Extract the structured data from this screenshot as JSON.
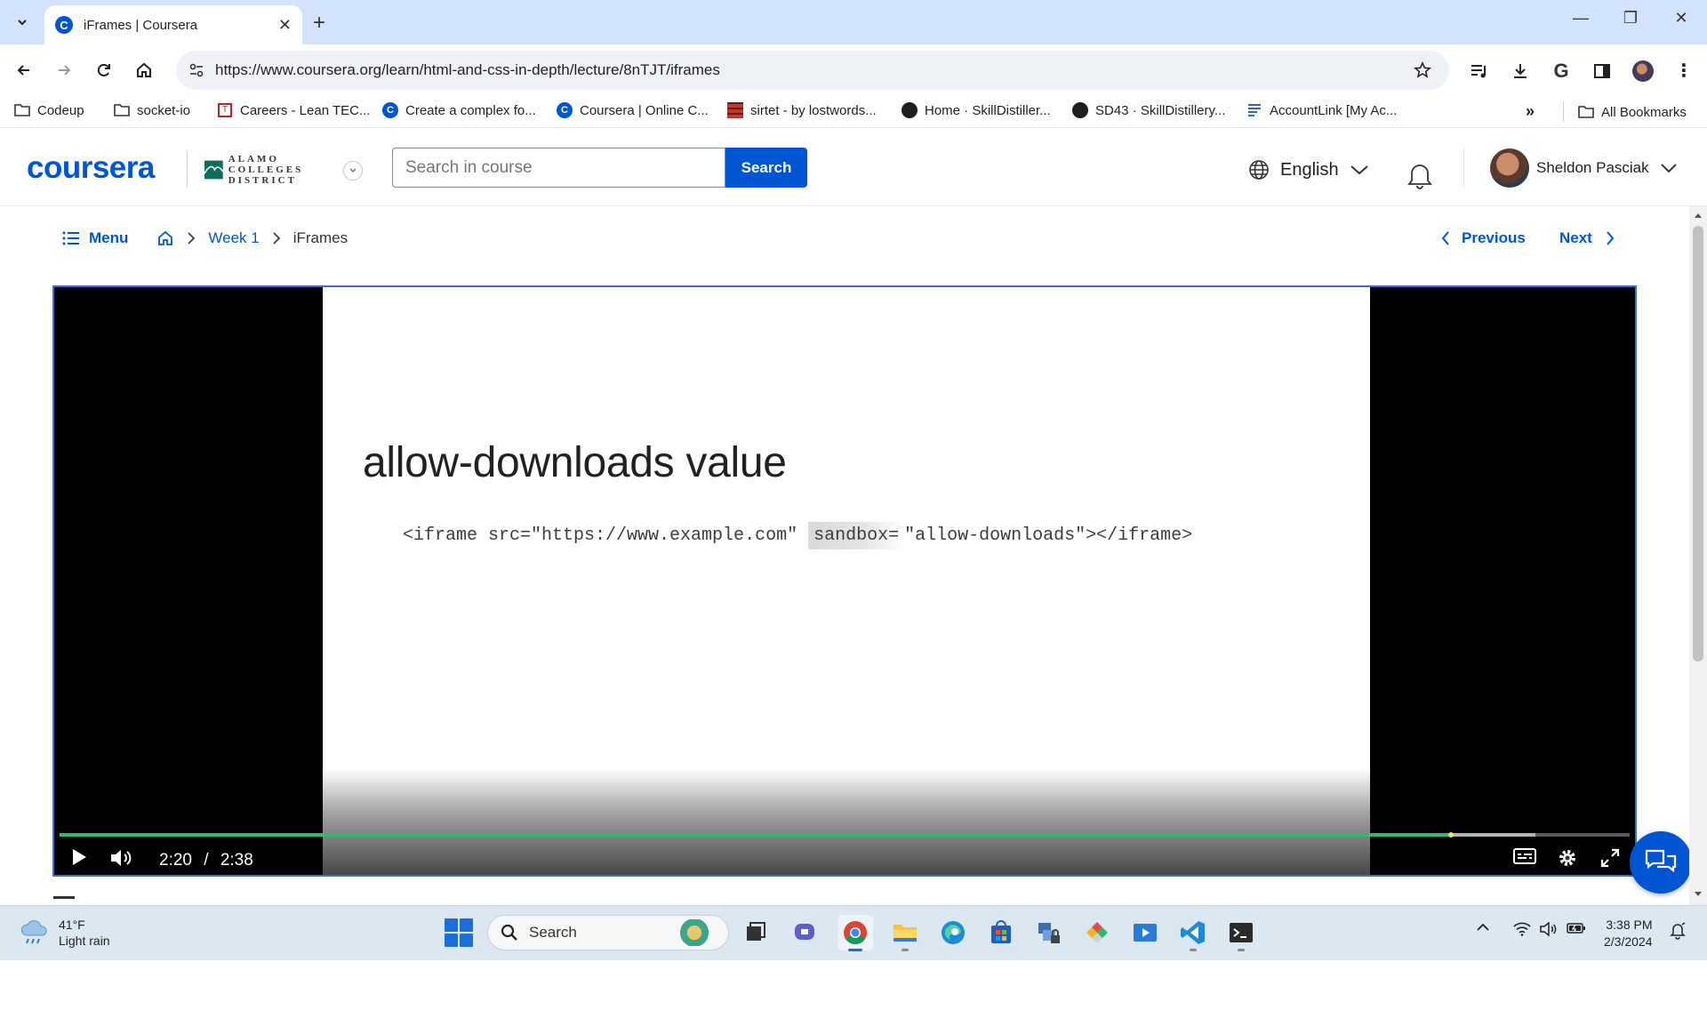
{
  "browser": {
    "tab_title": "iFrames | Coursera",
    "url": "https://www.coursera.org/learn/html-and-css-in-depth/lecture/8nTJT/iframes",
    "bookmarks": [
      {
        "label": "Codeup",
        "icon": "folder-icon"
      },
      {
        "label": "socket-io",
        "icon": "folder-icon"
      },
      {
        "label": "Careers - Lean TEC...",
        "icon": "lean-tec-favicon"
      },
      {
        "label": "Create a complex fo...",
        "icon": "coursera-favicon"
      },
      {
        "label": "Coursera | Online C...",
        "icon": "coursera-favicon"
      },
      {
        "label": "sirtet - by lostwords...",
        "icon": "sirtet-favicon"
      },
      {
        "label": "Home · SkillDistiller...",
        "icon": "github-favicon"
      },
      {
        "label": "SD43 · SkillDistillery...",
        "icon": "github-favicon"
      },
      {
        "label": "AccountLink [My Ac...",
        "icon": "accountlink-favicon"
      }
    ],
    "all_bookmarks": "All Bookmarks"
  },
  "header": {
    "logo": "coursera",
    "partner": "ALAMO COLLEGES DISTRICT",
    "search_placeholder": "Search in course",
    "search_button": "Search",
    "language": "English",
    "user_name": "Sheldon Pasciak"
  },
  "breadcrumb": {
    "menu": "Menu",
    "week": "Week 1",
    "current": "iFrames",
    "previous": "Previous",
    "next": "Next"
  },
  "video": {
    "slide_title": "allow-downloads value",
    "code_before": "<iframe src=\"https://www.example.com\" ",
    "code_highlight": "sandbox=",
    "code_after": "\"allow-downloads\"></iframe>",
    "current_time": "2:20",
    "time_separator": "/",
    "duration": "2:38",
    "progress_fraction": 0.886,
    "buffer_fraction": 0.94
  },
  "taskbar": {
    "temperature": "41°F",
    "weather": "Light rain",
    "search": "Search",
    "time": "3:38 PM",
    "date": "2/3/2024"
  },
  "colors": {
    "brand": "#0056d2",
    "progress": "#2eb872",
    "tab_strip": "#d3e3fd"
  }
}
